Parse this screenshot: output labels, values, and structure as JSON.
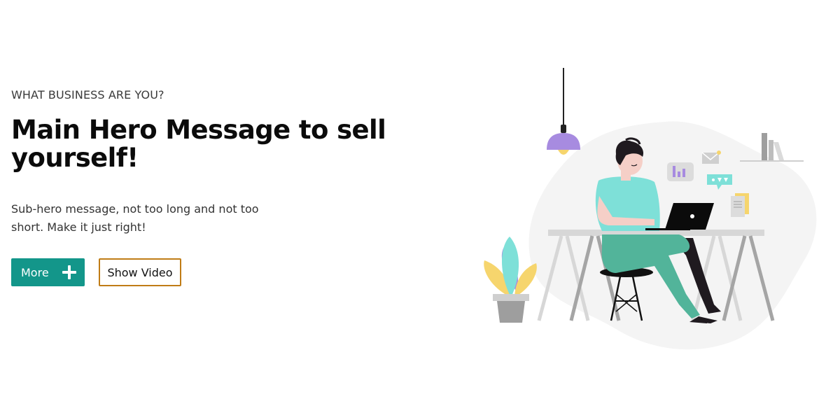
{
  "hero": {
    "eyebrow": "WHAT BUSINESS ARE YOU?",
    "headline": "Main Hero Message to sell yourself!",
    "subhero": "Sub-hero message, not too long and not too short. Make it just right!"
  },
  "actions": {
    "more_label": "More",
    "more_icon": "plus-icon",
    "video_label": "Show Video"
  },
  "colors": {
    "primary": "#13968a",
    "secondary_border": "#c07c16",
    "headline": "#0b0b0b",
    "body_text": "#333333"
  },
  "illustration": {
    "subject": "person-working-at-laptop-desk"
  }
}
